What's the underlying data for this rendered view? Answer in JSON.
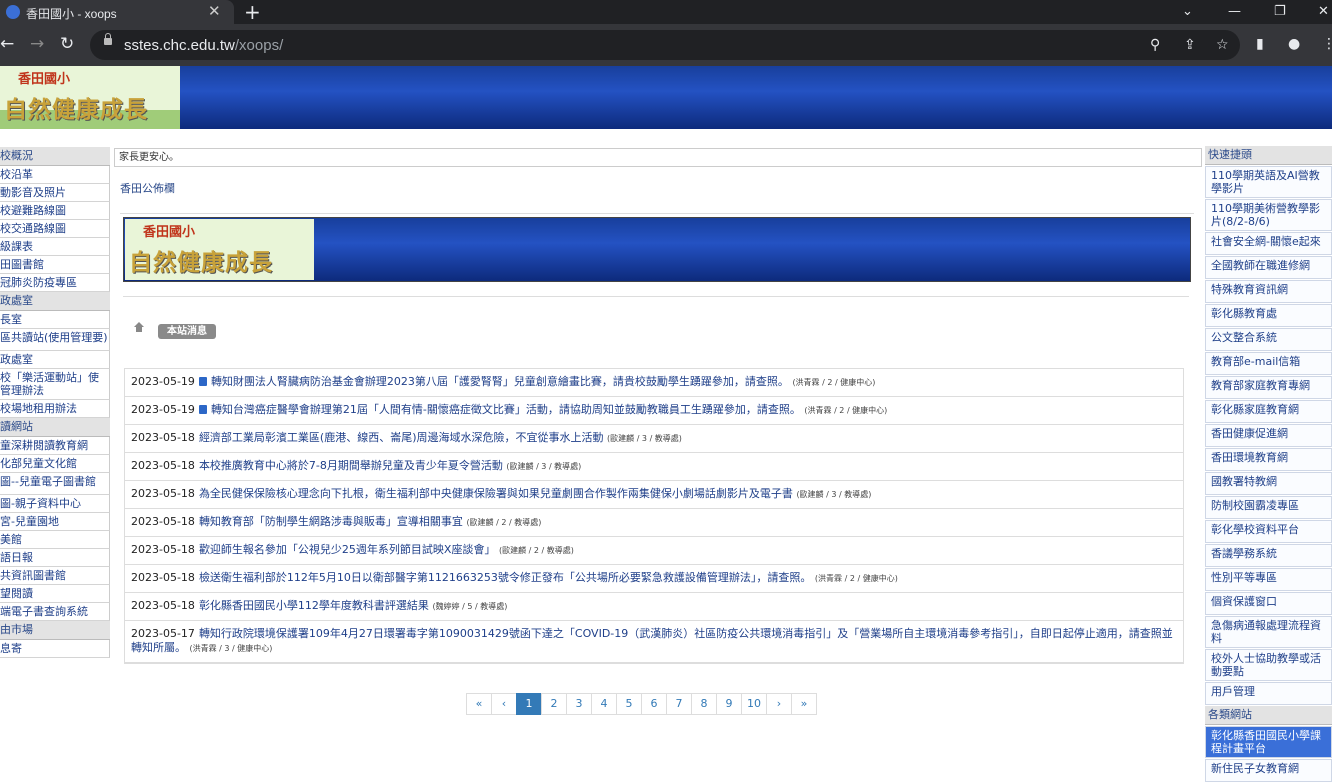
{
  "browser": {
    "tab_title": "香田國小 - xoops",
    "tab_close": "✕",
    "new_tab": "+",
    "url_host": "sstes.chc.edu.tw",
    "url_path": "/xoops/"
  },
  "banner": {
    "logo_top": "香田國小",
    "logo_main": "自然健康成長"
  },
  "left_sidebar": {
    "sections": [
      {
        "header": "校概況",
        "items": [
          "校沿革",
          "動影音及照片",
          "校避難路線圖",
          "校交通路線圖",
          "級課表",
          "田圖書館",
          "冠肺炎防疫專區"
        ]
      },
      {
        "header": "政處室",
        "items": [
          "長室",
          "區共讀站(使用管理要)",
          "政處室",
          "校「樂活運動站」使管理辦法",
          "校場地租用辦法"
        ]
      },
      {
        "header": "讀網站",
        "items": [
          "童深耕閱讀教育網",
          "化部兒童文化館",
          "圖--兒童電子圖書館",
          "圖-親子資料中心",
          "宮-兒童園地",
          "美館",
          "語日報",
          "共資訊圖書館",
          "望閱讀",
          "端電子書查詢系統"
        ]
      },
      {
        "header": "由市場",
        "items": [
          "息寄"
        ]
      }
    ]
  },
  "center": {
    "marquee": "家長更安心。",
    "section_title": "香田公佈欄",
    "breadcrumb": "本站消息",
    "news": [
      {
        "date": "2023-05-19",
        "pinned": true,
        "text": "轉知財團法人腎臟病防治基金會辦理2023第八屆「護愛腎腎」兒童創意繪畫比賽，請貴校鼓勵學生踴躍參加，請查照。",
        "meta": "(洪青霖 / 2 / 健康中心)"
      },
      {
        "date": "2023-05-19",
        "pinned": true,
        "text": "轉知台灣癌症醫學會辦理第21屆「人間有情-關懷癌症徵文比賽」活動，請協助周知並鼓勵教職員工生踴躍參加，請查照。",
        "meta": "(洪青霖 / 2 / 健康中心)"
      },
      {
        "date": "2023-05-18",
        "pinned": false,
        "text": "經濟部工業局彰濱工業區(鹿港、線西、崙尾)周邊海域水深危險，不宜從事水上活動",
        "meta": "(歐建麟 / 3 / 教導處)"
      },
      {
        "date": "2023-05-18",
        "pinned": false,
        "text": "本校推廣教育中心將於7-8月期間舉辦兒童及青少年夏令營活動",
        "meta": "(歐建麟 / 3 / 教導處)"
      },
      {
        "date": "2023-05-18",
        "pinned": false,
        "text": "為全民健保保險核心理念向下扎根，衛生福利部中央健康保險署與如果兒童劇團合作製作兩集健保小劇場話劇影片及電子書",
        "meta": "(歐建麟 / 3 / 教導處)"
      },
      {
        "date": "2023-05-18",
        "pinned": false,
        "text": "轉知教育部「防制學生網路涉毒與販毒」宣導相關事宜",
        "meta": "(歐建麟 / 2 / 教導處)"
      },
      {
        "date": "2023-05-18",
        "pinned": false,
        "text": "歡迎師生報名參加「公視兒少25週年系列節目試映X座談會」",
        "meta": "(歐建麟 / 2 / 教導處)"
      },
      {
        "date": "2023-05-18",
        "pinned": false,
        "text": "檢送衛生福利部於112年5月10日以衛部醫字第1121663253號令修正發布「公共場所必要緊急救護設備管理辦法」，請查照。",
        "meta": "(洪青霖 / 2 / 健康中心)"
      },
      {
        "date": "2023-05-18",
        "pinned": false,
        "text": "彰化縣香田國民小學112學年度教科書評選結果",
        "meta": "(魏婷婷 / 5 / 教導處)"
      },
      {
        "date": "2023-05-17",
        "pinned": false,
        "text": "轉知行政院環境保護署109年4月27日環署毒字第1090031429號函下達之「COVID-19（武漢肺炎）社區防疫公共環境消毒指引」及「營業場所自主環境消毒參考指引」，自即日起停止適用，請查照並轉知所屬。",
        "meta": "(洪青霖 / 3 / 健康中心)"
      }
    ],
    "pager": [
      "«",
      "‹",
      "1",
      "2",
      "3",
      "4",
      "5",
      "6",
      "7",
      "8",
      "9",
      "10",
      "›",
      "»"
    ]
  },
  "right_sidebar": {
    "header1": "快速捷頭",
    "links": [
      "110學期英語及AI營教學影片",
      "110學期美術營教學影片(8/2-8/6)",
      "社會安全網-關懷e起來",
      "全國教師在職進修網",
      "特殊教育資訊網",
      "彰化縣教育處",
      "公文整合系統",
      "教育部e-mail信箱",
      "教育部家庭教育專網",
      "彰化縣家庭教育網",
      "香田健康促進網",
      "香田環境教育網",
      "國教署特教網",
      "防制校園霸凌專區",
      "彰化學校資料平台",
      "香議學務系統",
      "性別平等專區",
      "個資保護窗口",
      "急傷病通報處理流程資料",
      "校外人士協助教學或活動要點",
      "用戶管理"
    ],
    "header2": "各類網站",
    "links2": [
      "彰化縣香田國民小學課程計畫平台",
      "新住民子女教育網"
    ]
  }
}
